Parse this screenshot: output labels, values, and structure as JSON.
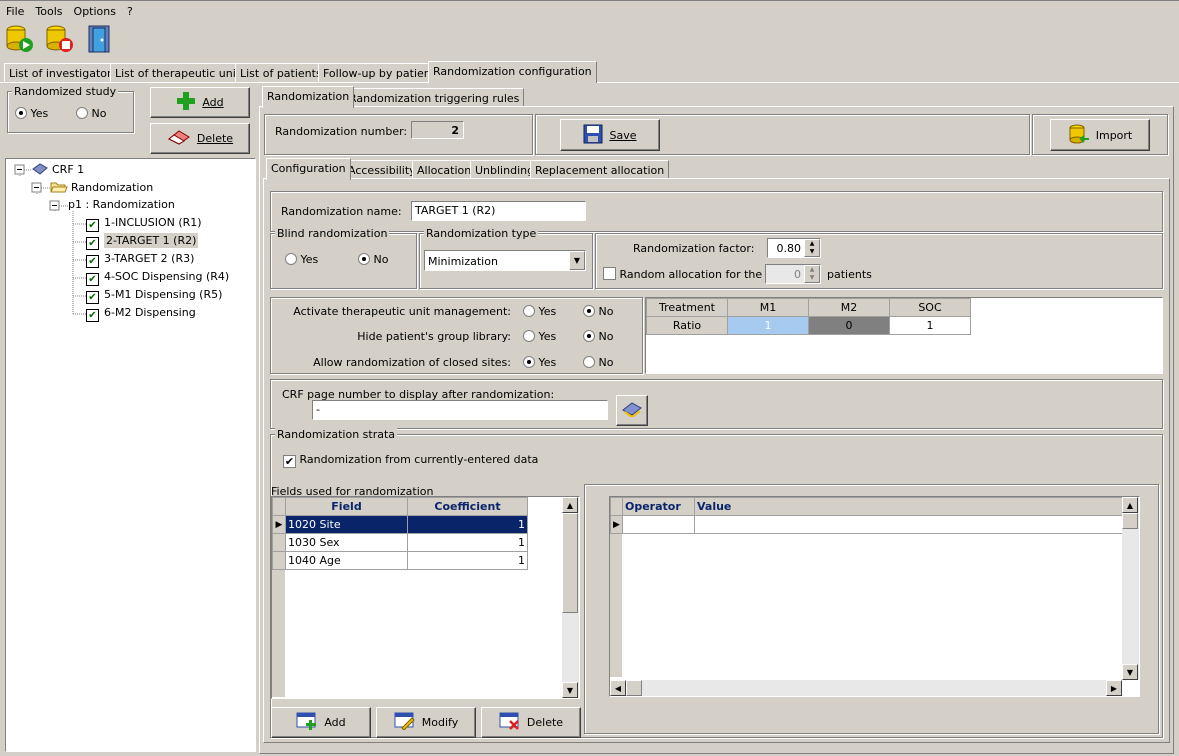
{
  "menu": {
    "file": "File",
    "tools": "Tools",
    "options": "Options",
    "help": "?"
  },
  "main_tabs": [
    "List of investigators",
    "List of therapeutic units",
    "List of patients",
    "Follow-up by patient",
    "Randomization configuration"
  ],
  "left": {
    "randomized_study_label": "Randomized study",
    "yes": "Yes",
    "no": "No",
    "selected": "Yes",
    "add_label": "Add",
    "delete_label": "Delete",
    "tree": {
      "root": "CRF 1",
      "folder": "Randomization",
      "page": "p1 : Randomization",
      "items": [
        "1-INCLUSION (R1)",
        "2-TARGET 1 (R2)",
        "3-TARGET 2 (R3)",
        "4-SOC Dispensing (R4)",
        "5-M1 Dispensing (R5)",
        "6-M2 Dispensing"
      ],
      "selected_item": "2-TARGET 1 (R2)"
    }
  },
  "right": {
    "sub_tabs": [
      "Randomization",
      "Randomization triggering rules"
    ],
    "rand_number_label": "Randomization number:",
    "rand_number": "2",
    "save_label": "Save",
    "import_label": "Import",
    "config_tabs": [
      "Configuration",
      "Accessibility",
      "Allocation",
      "Unblinding",
      "Replacement allocation"
    ],
    "rand_name_label": "Randomization name:",
    "rand_name": "TARGET 1 (R2)",
    "blind": {
      "label": "Blind randomization",
      "yes": "Yes",
      "no": "No",
      "selected": "No"
    },
    "type": {
      "label": "Randomization type",
      "value": "Minimization"
    },
    "factor": {
      "label": "Randomization factor:",
      "value": "0.80"
    },
    "random_alloc": {
      "label": "Random allocation for the first",
      "value": "0",
      "suffix": "patients",
      "checked": false
    },
    "options": [
      {
        "label": "Activate therapeutic unit management:",
        "yes": "Yes",
        "no": "No",
        "selected": "No"
      },
      {
        "label": "Hide patient's group library:",
        "yes": "Yes",
        "no": "No",
        "selected": "No"
      },
      {
        "label": "Allow randomization of closed sites:",
        "yes": "Yes",
        "no": "No",
        "selected": "Yes"
      }
    ],
    "treatment_table": {
      "header": [
        "Treatment",
        "M1",
        "M2",
        "SOC"
      ],
      "row_label": "Ratio",
      "values": [
        "1",
        "0",
        "1"
      ]
    },
    "crf_page": {
      "label": "CRF page number to display after randomization:",
      "value": "-"
    },
    "strata": {
      "label": "Randomization strata",
      "checkbox_label": "Randomization from currently-entered data",
      "checked": true
    },
    "fields": {
      "label": "Fields used for randomization",
      "headers": [
        "Field",
        "Coefficient"
      ],
      "rows": [
        {
          "field": "1020 Site",
          "coef": "1"
        },
        {
          "field": "1030 Sex",
          "coef": "1"
        },
        {
          "field": "1040 Age",
          "coef": "1"
        }
      ]
    },
    "operator_grid": {
      "headers": [
        "Operator",
        "Value"
      ]
    },
    "bottom_buttons": {
      "add": "Add",
      "modify": "Modify",
      "delete": "Delete"
    }
  },
  "colors": {
    "m1_cell": "#a6caf0",
    "m2_cell": "#808080",
    "selected_row": "#0a246a"
  }
}
